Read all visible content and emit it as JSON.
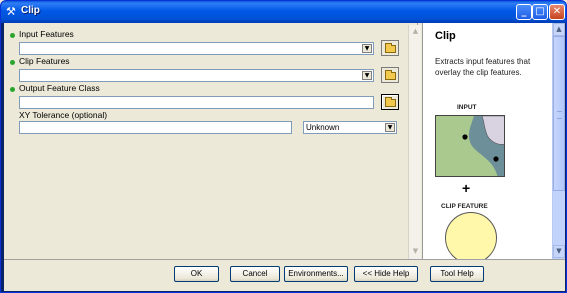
{
  "window": {
    "title": "Clip"
  },
  "form": {
    "input_features": {
      "label": "Input Features",
      "value": ""
    },
    "clip_features": {
      "label": "Clip Features",
      "value": ""
    },
    "output_feature_class": {
      "label": "Output Feature Class",
      "value": ""
    },
    "xy_tolerance": {
      "label": "XY Tolerance (optional)",
      "value": "",
      "unit": "Unknown"
    }
  },
  "help": {
    "title": "Clip",
    "description": "Extracts input features that overlay the clip features.",
    "input_label": "INPUT",
    "plus": "+",
    "clip_label": "CLIP FEATURE"
  },
  "buttons": {
    "ok": "OK",
    "cancel": "Cancel",
    "environments": "Environments...",
    "hide_help": "<< Hide Help",
    "tool_help": "Tool Help"
  },
  "colors": {
    "title_bar": "#0058e6",
    "required_dot": "#2ba52b",
    "map_water": "#6d8f9a",
    "map_land": "#a9c98e",
    "clip_circle": "#fff7aa"
  }
}
